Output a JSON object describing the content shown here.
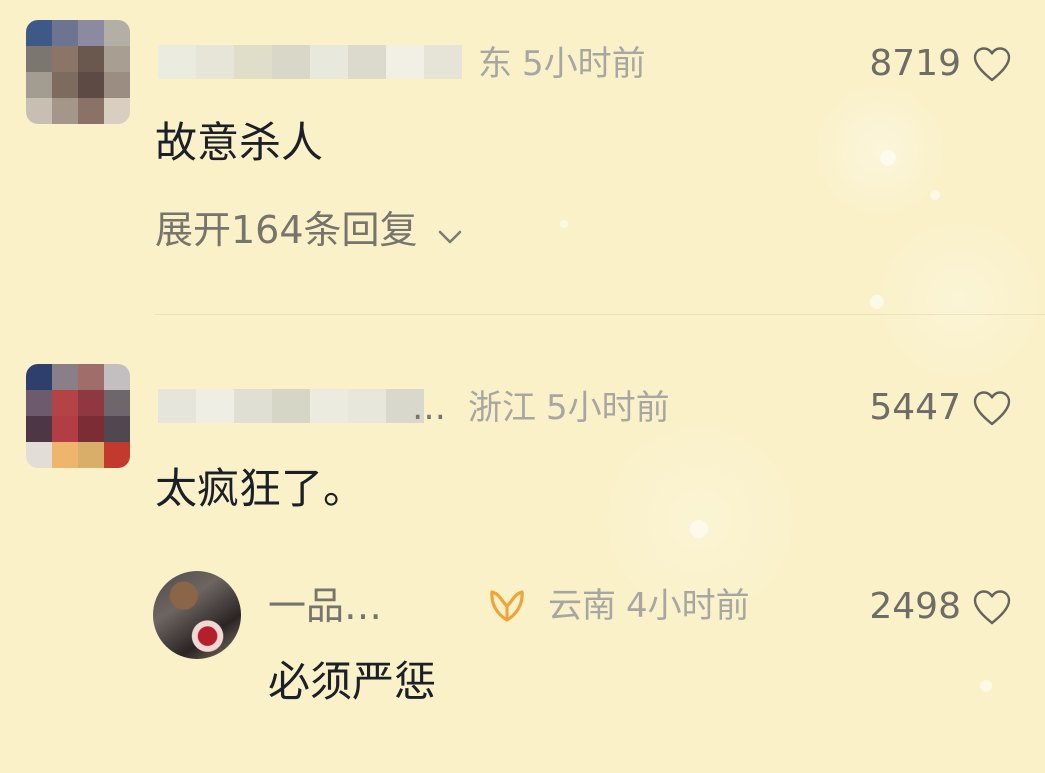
{
  "comments": [
    {
      "location": "东",
      "time": "5小时前",
      "likes": "8719",
      "text": "故意杀人",
      "expand_label": "展开164条回复"
    },
    {
      "name_suffix": "…",
      "location": "浙江",
      "time": "5小时前",
      "likes": "5447",
      "text": "太疯狂了。",
      "replies": [
        {
          "name": "一品…",
          "location": "云南",
          "time": "4小时前",
          "likes": "2498",
          "text": "必须严惩"
        }
      ]
    }
  ],
  "icons": {
    "like": "heart-outline-icon",
    "expand": "chevron-down-icon",
    "badge": "ribbon-badge-icon"
  },
  "colors": {
    "background": "#faf1c8",
    "text_primary": "#1b1f28",
    "text_secondary": "#a7a6a3",
    "badge": "#f0a437"
  }
}
